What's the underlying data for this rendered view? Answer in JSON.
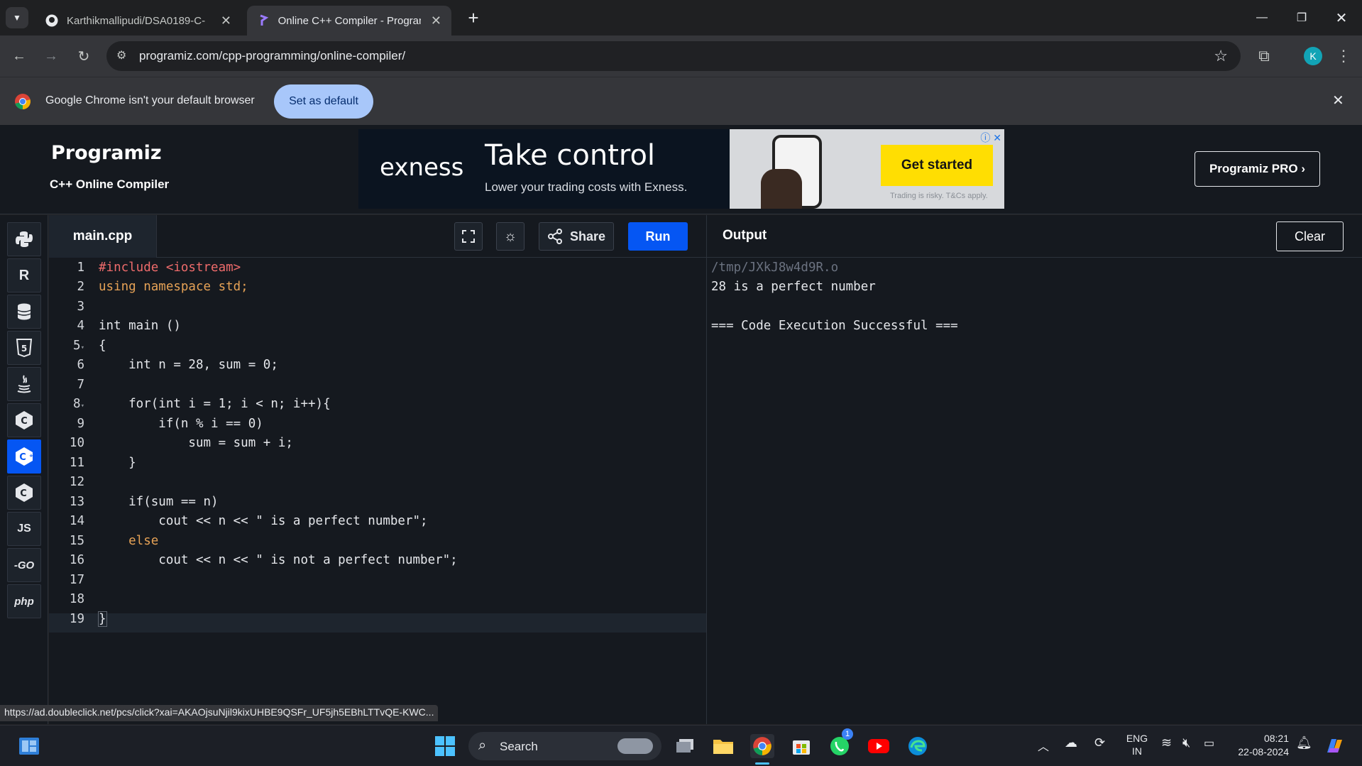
{
  "browser": {
    "tabs": [
      {
        "title": "Karthikmallipudi/DSA0189-C-",
        "active": false,
        "icon": "github-icon"
      },
      {
        "title": "Online C++ Compiler - Program",
        "active": true,
        "icon": "programiz-icon"
      }
    ],
    "new_tab_label": "+",
    "url": "programiz.com/cpp-programming/online-compiler/",
    "profile_initial": "K"
  },
  "infobar": {
    "message": "Google Chrome isn't your default browser",
    "button": "Set as default"
  },
  "site": {
    "logo": "Programiz",
    "subtitle": "C++ Online Compiler",
    "pro_button": "Programiz PRO ›",
    "ad": {
      "brand": "exness",
      "headline": "Take control",
      "subline": "Lower your trading costs with Exness.",
      "cta": "Get started",
      "note": "Trading is risky. T&Cs apply."
    }
  },
  "languages": [
    {
      "name": "python-icon",
      "label": "",
      "active": false
    },
    {
      "name": "r-icon",
      "label": "R",
      "active": false
    },
    {
      "name": "sql-icon",
      "label": "",
      "active": false
    },
    {
      "name": "html-icon",
      "label": "5",
      "active": false
    },
    {
      "name": "java-icon",
      "label": "",
      "active": false
    },
    {
      "name": "c-icon",
      "label": "C",
      "active": false
    },
    {
      "name": "cpp-icon",
      "label": "C",
      "active": true
    },
    {
      "name": "csharp-icon",
      "label": "C",
      "active": false
    },
    {
      "name": "js-icon",
      "label": "JS",
      "active": false
    },
    {
      "name": "go-icon",
      "label": "-GO",
      "active": false
    },
    {
      "name": "php-icon",
      "label": "php",
      "active": false
    }
  ],
  "editor": {
    "filename": "main.cpp",
    "share_label": "Share",
    "run_label": "Run",
    "lines": [
      "#include <iostream>",
      "using namespace std;",
      "",
      "int main ()",
      "{",
      "    int n = 28, sum = 0;",
      "",
      "    for(int i = 1; i < n; i++){",
      "        if(n % i == 0)",
      "            sum = sum + i;",
      "    }",
      "",
      "    if(sum == n)",
      "        cout << n << \" is a perfect number\";",
      "    else",
      "        cout << n << \" is not a perfect number\";",
      "",
      "",
      "}"
    ]
  },
  "output": {
    "title": "Output",
    "clear_label": "Clear",
    "lines": [
      "/tmp/JXkJ8w4d9R.o",
      "28 is a perfect number",
      "",
      "=== Code Execution Successful ==="
    ]
  },
  "status_url": "https://ad.doubleclick.net/pcs/click?xai=AKAOjsuNjil9kixUHBE9QSFr_UF5jh5EBhLTTvQE-KWC...",
  "taskbar": {
    "search_label": "Search",
    "lang_top": "ENG",
    "lang_bottom": "IN",
    "time": "08:21",
    "date": "22-08-2024",
    "whatsapp_badge": "1"
  },
  "colors": {
    "accent": "#0556f3",
    "editor_bg": "#15191f",
    "keyword": "#e6a256",
    "number": "#ff8e6b",
    "string": "#e0c28a"
  }
}
